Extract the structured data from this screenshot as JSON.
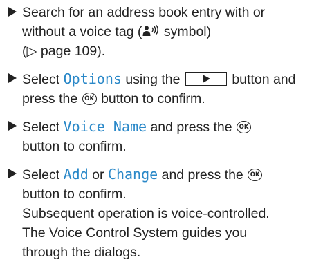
{
  "steps": [
    {
      "l1": "Search for an address book entry with or",
      "l2a": "without a voice tag (",
      "l2b": " symbol)",
      "l3": "(▷ page 109)."
    },
    {
      "l1a": "Select ",
      "kw": "Options",
      "l1b": " using the ",
      "l1c": " button and",
      "l2a": "press the ",
      "l2b": " button to confirm."
    },
    {
      "l1a": "Select ",
      "kw": "Voice Name",
      "l1b": " and press the ",
      "l2": "button to confirm."
    },
    {
      "l1a": "Select ",
      "kw1": "Add",
      "l1b": " or ",
      "kw2": "Change",
      "l1c": " and press the ",
      "l2": "button to confirm.",
      "l3": "Subsequent operation is voice-controlled.",
      "l4": "The Voice Control System guides you",
      "l5": "through the dialogs."
    }
  ],
  "icons": {
    "bullet": "triangle-right",
    "ok": "OK",
    "voice_tag": "person-with-sound-waves",
    "button": "play-right-button"
  },
  "colors": {
    "text": "#222222",
    "keyword": "#2a88c8"
  }
}
